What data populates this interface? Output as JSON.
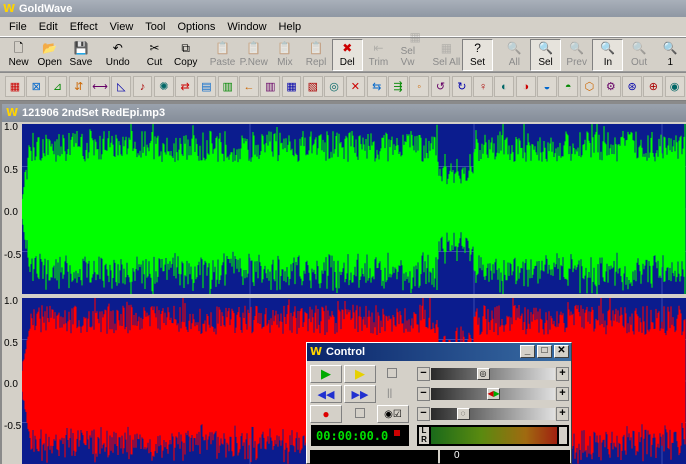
{
  "app": {
    "title": "GoldWave",
    "logo": "W"
  },
  "menu": [
    "File",
    "Edit",
    "Effect",
    "View",
    "Tool",
    "Options",
    "Window",
    "Help"
  ],
  "toolbar": [
    {
      "label": "New",
      "icon": "new-icon",
      "glyph": "🗋",
      "enabled": true
    },
    {
      "label": "Open",
      "icon": "open-icon",
      "glyph": "📂",
      "enabled": true
    },
    {
      "label": "Save",
      "icon": "save-icon",
      "glyph": "💾",
      "enabled": true
    },
    {
      "label": "Undo",
      "icon": "undo-icon",
      "glyph": "↶",
      "enabled": true
    },
    {
      "label": "Cut",
      "icon": "cut-icon",
      "glyph": "✂",
      "enabled": true
    },
    {
      "label": "Copy",
      "icon": "copy-icon",
      "glyph": "⧉",
      "enabled": true
    },
    {
      "label": "Paste",
      "icon": "paste-icon",
      "glyph": "📋",
      "enabled": false
    },
    {
      "label": "P.New",
      "icon": "paste-new-icon",
      "glyph": "📋",
      "enabled": false
    },
    {
      "label": "Mix",
      "icon": "mix-icon",
      "glyph": "📋",
      "enabled": false
    },
    {
      "label": "Repl",
      "icon": "replace-icon",
      "glyph": "📋",
      "enabled": false
    },
    {
      "label": "Del",
      "icon": "delete-icon",
      "glyph": "✖",
      "enabled": true,
      "pressed": true,
      "color": "#cc0000"
    },
    {
      "label": "Trim",
      "icon": "trim-icon",
      "glyph": "⇤",
      "enabled": false
    },
    {
      "label": "Sel Vw",
      "icon": "select-view-icon",
      "glyph": "▦",
      "enabled": false
    },
    {
      "label": "Sel All",
      "icon": "select-all-icon",
      "glyph": "▦",
      "enabled": false
    },
    {
      "label": "Set",
      "icon": "set-icon",
      "glyph": "?",
      "enabled": true,
      "pressed": true
    },
    {
      "label": "All",
      "icon": "zoom-all-icon",
      "glyph": "🔍",
      "enabled": false
    },
    {
      "label": "Sel",
      "icon": "zoom-selection-icon",
      "glyph": "🔍",
      "enabled": true,
      "pressed": true
    },
    {
      "label": "Prev",
      "icon": "zoom-previous-icon",
      "glyph": "🔍",
      "enabled": false
    },
    {
      "label": "In",
      "icon": "zoom-in-icon",
      "glyph": "🔍",
      "enabled": true,
      "pressed": true
    },
    {
      "label": "Out",
      "icon": "zoom-out-icon",
      "glyph": "🔍",
      "enabled": false
    },
    {
      "label": "1",
      "icon": "zoom-one-icon",
      "glyph": "🔍",
      "enabled": true
    }
  ],
  "effects_toolbar": [
    "auto-gain-icon",
    "channel-mixer-icon",
    "compressor-icon",
    "doppler-icon",
    "dynamics-icon",
    "echo-icon",
    "envelope-icon",
    "equalizer-icon",
    "fade-in-icon",
    "fade-out-icon",
    "filter-icon",
    "flanger-icon",
    "invert-icon",
    "mechanize-icon",
    "noise-reduction-icon",
    "offset-icon",
    "pan-icon",
    "parametric-eq-icon",
    "pitch-icon",
    "playback-rate-icon",
    "resample-icon",
    "reverb-icon",
    "reverse-icon",
    "silence-icon",
    "spatial-icon",
    "time-warp-icon",
    "volume-change-icon",
    "volume-shape-icon",
    "match-volume-icon",
    "maximize-volume-icon",
    "smoother-icon",
    "pop-click-icon"
  ],
  "document": {
    "title": "121906 2ndSet RedEpi.mp3",
    "logo": "W"
  },
  "channels": [
    {
      "name": "left",
      "color": "#00ff00",
      "ticks": [
        "1.0",
        "0.5",
        "0.0",
        "-0.5"
      ]
    },
    {
      "name": "right",
      "color": "#ff0000",
      "ticks": [
        "1.0",
        "0.5",
        "0.0",
        "-0.5"
      ]
    }
  ],
  "control": {
    "title": "Control",
    "logo": "W",
    "time": "00:00:00.0",
    "meter_labels": [
      "L",
      "R"
    ],
    "volume_level": 0.41,
    "balance_level": 0.5,
    "speed_level": 0.23,
    "bottom_readout": "0"
  }
}
